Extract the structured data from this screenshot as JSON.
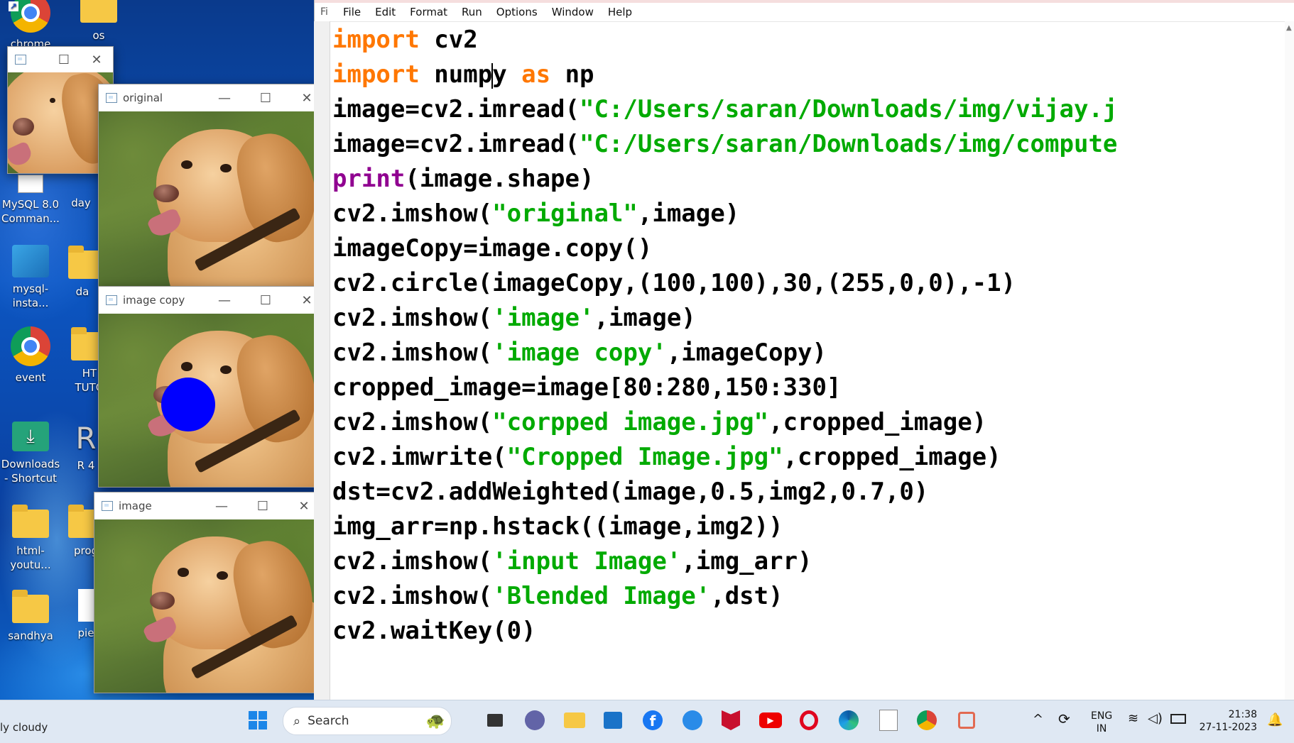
{
  "desktop": {
    "icons": [
      {
        "label": "chrome"
      },
      {
        "label": "os"
      },
      {
        "label": "MySQL 8.0 Comman..."
      },
      {
        "label": "day"
      },
      {
        "label": "mysql-insta..."
      },
      {
        "label": "da"
      },
      {
        "label": "event"
      },
      {
        "label": "HT TUTO"
      },
      {
        "label": "Downloads - Shortcut"
      },
      {
        "label": "R 4"
      },
      {
        "label": "html-youtu..."
      },
      {
        "label": "prog"
      },
      {
        "label": "sandhya"
      },
      {
        "label": "pie"
      }
    ]
  },
  "windows": {
    "small": {
      "title": ""
    },
    "original": {
      "title": "original"
    },
    "image_copy": {
      "title": "image copy"
    },
    "image": {
      "title": "image"
    },
    "controls": {
      "minimize": "—",
      "maximize": "☐",
      "close": "✕"
    }
  },
  "editor": {
    "title_fragment": "Fi",
    "menu": [
      "File",
      "Edit",
      "Format",
      "Run",
      "Options",
      "Window",
      "Help"
    ],
    "code_lines": [
      "import cv2",
      "import numpy as np",
      "image=cv2.imread(\"C:/Users/saran/Downloads/img/vijay.j",
      "image=cv2.imread(\"C:/Users/saran/Downloads/img/compute",
      "print(image.shape)",
      "cv2.imshow(\"original\",image)",
      "imageCopy=image.copy()",
      "cv2.circle(imageCopy,(100,100),30,(255,0,0),-1)",
      "cv2.imshow('image',image)",
      "cv2.imshow('image copy',imageCopy)",
      "cropped_image=image[80:280,150:330]",
      "cv2.imshow(\"corpped image.jpg\",cropped_image)",
      "cv2.imwrite(\"Cropped Image.jpg\",cropped_image)",
      "dst=cv2.addWeighted(image,0.5,img2,0.7,0)",
      "img_arr=np.hstack((image,img2))",
      "cv2.imshow('input Image',img_arr)",
      "cv2.imshow('Blended Image',dst)",
      "cv2.waitKey(0)"
    ],
    "syntax_colors": {
      "keyword": "#ff7700",
      "string": "#00aa00",
      "builtin": "#900090"
    }
  },
  "taskbar": {
    "weather": "ly cloudy",
    "search_placeholder": "Search",
    "language_line1": "ENG",
    "language_line2": "IN",
    "time": "21:38",
    "date": "27-11-2023"
  },
  "colors": {
    "circle_blue": "#0000ff"
  }
}
